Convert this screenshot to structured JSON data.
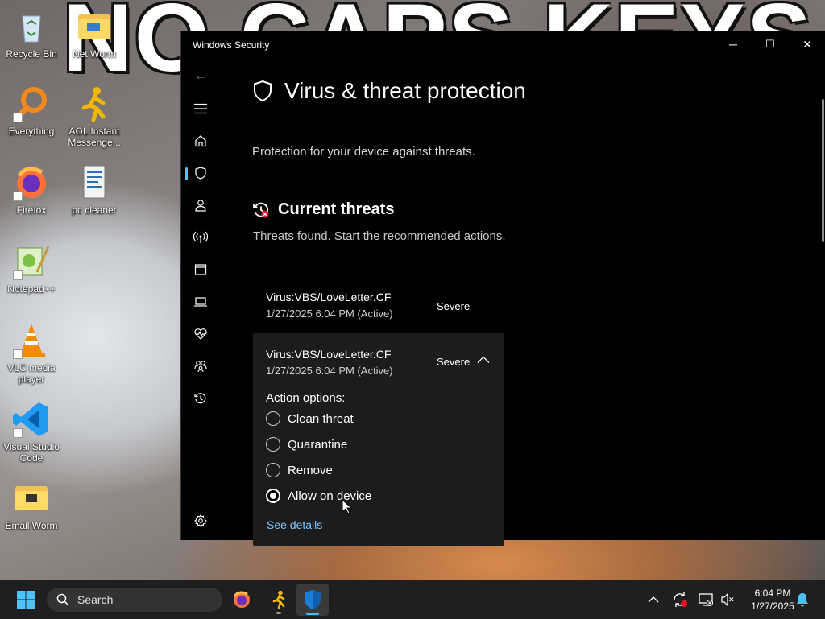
{
  "desktop": {
    "banner_text": "NO CAPS KEYS",
    "icons": [
      {
        "label": "Recycle Bin"
      },
      {
        "label": "Net Worm"
      },
      {
        "label": "Everything"
      },
      {
        "label": "AOL Instant Messenge..."
      },
      {
        "label": "Firefox"
      },
      {
        "label": "pc cleaner"
      },
      {
        "label": "Notepad++"
      },
      {
        "label": "VLC media player"
      },
      {
        "label": "Visual Studio Code"
      },
      {
        "label": "Email Worm"
      }
    ]
  },
  "window": {
    "title": "Windows Security",
    "controls": {
      "minimize": "─",
      "maximize": "☐",
      "close": "✕"
    }
  },
  "nav": {
    "back": "←",
    "active_item": "virus-threat-protection",
    "items": [
      "menu",
      "home",
      "virus-threat-protection",
      "account-protection",
      "firewall-network",
      "app-browser-control",
      "device-security",
      "device-performance-health",
      "family-options",
      "protection-history",
      "settings"
    ]
  },
  "page": {
    "title": "Virus & threat protection",
    "subtitle": "Protection for your device against threats.",
    "section_title": "Current threats",
    "section_subtitle": "Threats found. Start the recommended actions."
  },
  "threats": [
    {
      "name": "Virus:VBS/LoveLetter.CF",
      "date": "1/27/2025 6:04 PM (Active)",
      "severity": "Severe"
    },
    {
      "name": "Virus:VBS/LoveLetter.CF",
      "date": "1/27/2025 6:04 PM (Active)",
      "severity": "Severe"
    }
  ],
  "actions": {
    "label": "Action options:",
    "options": [
      "Clean threat",
      "Quarantine",
      "Remove",
      "Allow on device"
    ],
    "selected": "Allow on device",
    "see_details": "See details"
  },
  "taskbar": {
    "search_placeholder": "Search",
    "time": "6:04 PM",
    "date": "1/27/2025"
  },
  "colors": {
    "accent": "#4cc2ff",
    "link": "#7fc7ff",
    "window_bg": "#000000",
    "panel_bg": "#1c1c1c",
    "taskbar_bg": "#1f1f1f"
  }
}
